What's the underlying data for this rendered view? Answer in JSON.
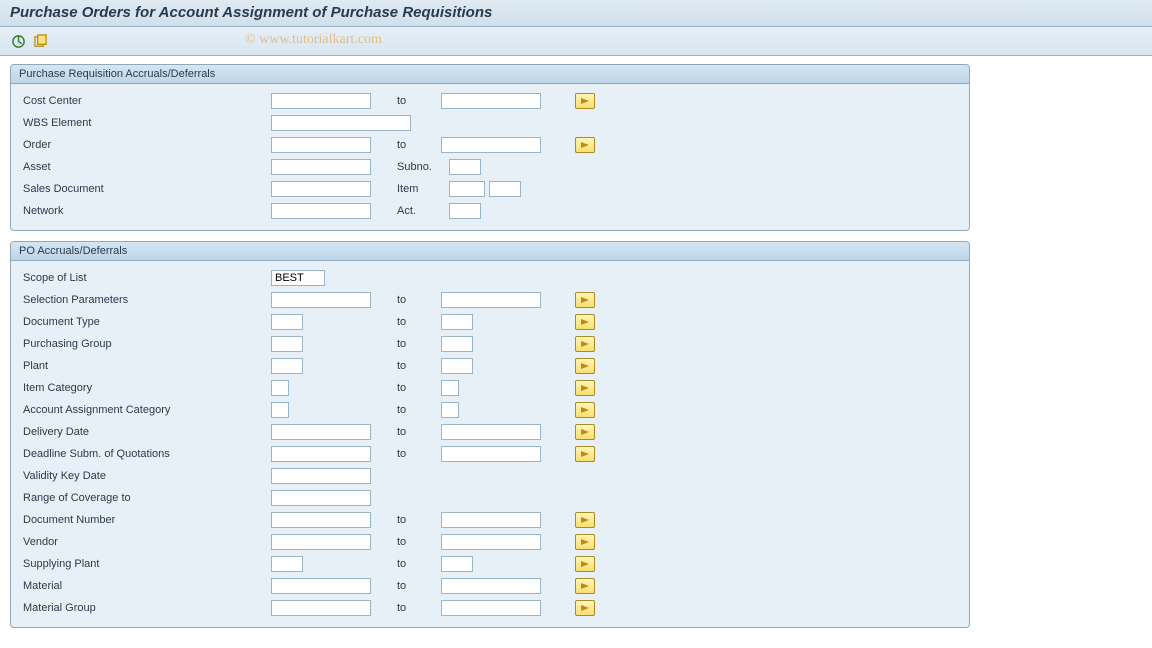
{
  "title": "Purchase Orders for Account Assignment of Purchase Requisitions",
  "watermark": "© www.tutorialkart.com",
  "labels": {
    "to": "to",
    "subno": "Subno.",
    "item": "Item",
    "act": "Act."
  },
  "group1": {
    "title": "Purchase Requisition Accruals/Deferrals",
    "fields": {
      "cost_center": "Cost Center",
      "wbs": "WBS Element",
      "order": "Order",
      "asset": "Asset",
      "sales_doc": "Sales Document",
      "network": "Network"
    }
  },
  "group2": {
    "title": "PO Accruals/Deferrals",
    "fields": {
      "scope_of_list": "Scope of List",
      "selection_params": "Selection Parameters",
      "doc_type": "Document Type",
      "purch_group": "Purchasing Group",
      "plant": "Plant",
      "item_cat": "Item Category",
      "acct_assign_cat": "Account Assignment Category",
      "delivery_date": "Delivery Date",
      "deadline": "Deadline Subm. of Quotations",
      "validity_key": "Validity Key Date",
      "range_coverage": "Range of Coverage to",
      "doc_number": "Document Number",
      "vendor": "Vendor",
      "supplying_plant": "Supplying Plant",
      "material": "Material",
      "material_group": "Material Group"
    },
    "values": {
      "scope_of_list": "BEST"
    }
  }
}
